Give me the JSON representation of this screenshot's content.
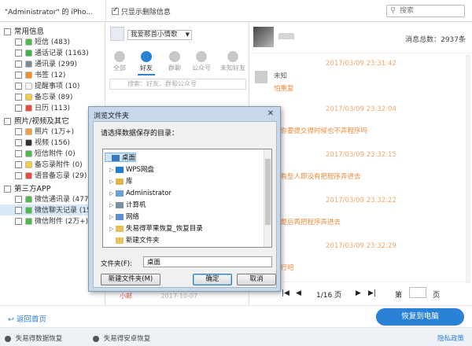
{
  "topbar": {
    "device": "\"Administrator\" 的 iPho...",
    "filter_label": "只显示删除信息",
    "search_placeholder": "搜索"
  },
  "tree": {
    "groups": [
      {
        "label": "常用信息",
        "items": [
          {
            "label": "短信 (483)",
            "color": "#4cba4f"
          },
          {
            "label": "通话记录 (1163)",
            "color": "#3fb24b"
          },
          {
            "label": "通讯录 (299)",
            "color": "#7e8a96"
          },
          {
            "label": "书签 (12)",
            "color": "#f0912c"
          },
          {
            "label": "提醒事项 (10)",
            "color": "#f4f4f4"
          },
          {
            "label": "备忘录 (89)",
            "color": "#f4cf3c"
          },
          {
            "label": "日历 (113)",
            "color": "#e84a3c"
          }
        ]
      },
      {
        "label": "照片/视频及其它",
        "items": [
          {
            "label": "照片 (1万+)",
            "color": "#f0a040"
          },
          {
            "label": "视频 (156)",
            "color": "#333333"
          },
          {
            "label": "短信附件 (0)",
            "color": "#4cba4f"
          },
          {
            "label": "备忘录附件 (0)",
            "color": "#f4cf3c"
          },
          {
            "label": "语音备忘录 (29)",
            "color": "#e84a3c"
          }
        ]
      },
      {
        "label": "第三方APP",
        "items": [
          {
            "label": "微信通讯录 (4779",
            "color": "#4cba4f"
          },
          {
            "label": "微信聊天记录 (15",
            "color": "#4cba4f",
            "selected": true
          },
          {
            "label": "微信附件 (2万+)",
            "color": "#4cba4f"
          }
        ]
      }
    ]
  },
  "contacts": {
    "account": "我爱那首小情歌",
    "tabs": [
      "全部",
      "好友",
      "群聊",
      "公众号",
      "未知好友"
    ],
    "search_placeholder": "搜索：好友、群和公众号",
    "bottom_name": "小邮",
    "bottom_date": "2017-10-07"
  },
  "chat": {
    "total": "消息总数：2937条",
    "timestamps": [
      "2017/03/09 23:31:42",
      "2017/03/09 23:32:04",
      "2017/03/09 23:32:15",
      "2017/03/09 23:32:22",
      "2017/03/09 23:32:29"
    ],
    "sender": "未知",
    "messages": [
      "怕重复",
      "是你要提交得时候也不弄程序吗",
      "为有些人即没有把程序弄进去",
      "这是后再把程序弄进去",
      "不行吧"
    ]
  },
  "pager": {
    "info": "1/16 页",
    "go_label": "第",
    "page_suffix": "页"
  },
  "bottom": {
    "back": "返回首页",
    "recover": "恢复到电脑"
  },
  "footer": {
    "item1": "失易得数据恢复",
    "item2": "失易得安卓恢复",
    "privacy": "隐私政策"
  },
  "dialog": {
    "title": "浏览文件夹",
    "prompt": "请选择数据保存的目录：",
    "nodes": [
      "桌面",
      "WPS网盘",
      "库",
      "Administrator",
      "计算机",
      "网络",
      "失易得苹果恢复_恢复目录",
      "新建文件夹"
    ],
    "folder_label": "文件夹(F):",
    "folder_value": "桌面",
    "new_folder": "新建文件夹(M)",
    "ok": "确定",
    "cancel": "取消"
  }
}
